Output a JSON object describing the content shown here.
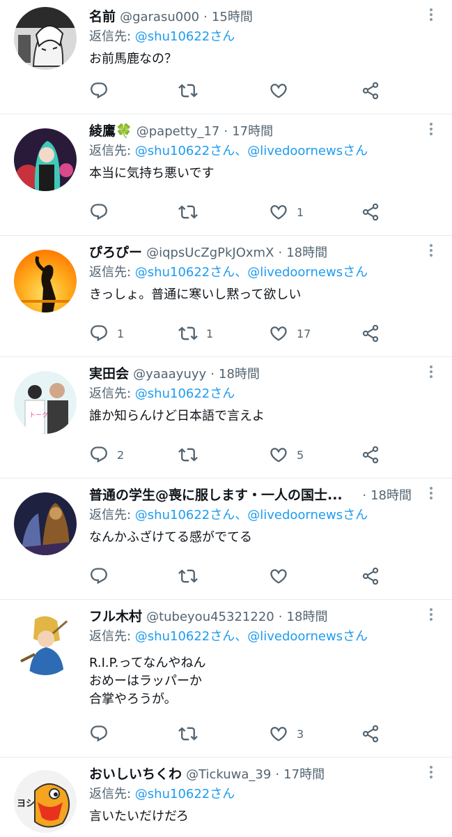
{
  "reply_prefix": "返信先: ",
  "tweets": [
    {
      "name": "名前",
      "name_suffix": "",
      "handle": "@garasu000",
      "time": "15時間",
      "reply_to": "@shu10622さん",
      "text": "お前馬鹿なの？",
      "counts": {
        "reply": "",
        "retweet": "",
        "like": ""
      }
    },
    {
      "name": "綾鷹",
      "name_suffix": "🍀",
      "handle": "@papetty_17",
      "time": "17時間",
      "reply_to": "@shu10622さん、@livedoornewsさん",
      "text": "本当に気持ち悪いです",
      "counts": {
        "reply": "",
        "retweet": "",
        "like": "1"
      }
    },
    {
      "name": "ぴろぴー",
      "name_suffix": "",
      "handle": "@iqpsUcZgPkJOxmX",
      "time": "18時間",
      "reply_to": "@shu10622さん、@livedoornewsさん",
      "text": "きっしょ。普通に寒いし黙って欲しい",
      "counts": {
        "reply": "1",
        "retweet": "1",
        "like": "17"
      }
    },
    {
      "name": "実田会",
      "name_suffix": "",
      "handle": "@yaaayuyy",
      "time": "18時間",
      "reply_to": "@shu10622さん",
      "text": "誰か知らんけど日本語で言えよ",
      "counts": {
        "reply": "2",
        "retweet": "",
        "like": "5"
      }
    },
    {
      "name": "普通の学生@喪に服します・一人の国士...",
      "name_suffix": "",
      "handle": "",
      "time": "18時間",
      "reply_to": "@shu10622さん、@livedoornewsさん",
      "text": "なんかふざけてる感がでてる",
      "counts": {
        "reply": "",
        "retweet": "",
        "like": ""
      }
    },
    {
      "name": "フル木村",
      "name_suffix": "",
      "handle": "@tubeyou45321220",
      "time": "18時間",
      "reply_to": "@shu10622さん、@livedoornewsさん",
      "text": "R.I.P.ってなんやねん\nおめーはラッパーか\n合掌やろうが。",
      "counts": {
        "reply": "",
        "retweet": "",
        "like": "3"
      }
    },
    {
      "name": "おいしいちくわ",
      "name_suffix": "",
      "handle": "@Tickuwa_39",
      "time": "17時間",
      "reply_to": "@shu10622さん",
      "text": "言いたいだけだろ",
      "counts": {
        "reply": "",
        "retweet": "",
        "like": ""
      }
    }
  ],
  "avatar_logo_text": "ヨシ",
  "icons": {
    "reply": "reply-icon",
    "retweet": "retweet-icon",
    "like": "heart-icon",
    "share": "share-icon",
    "more": "more-options-icon"
  },
  "colors": {
    "link": "#1d9bf0",
    "meta": "#536471",
    "text": "#0f1419",
    "clover": "#2fa84f"
  }
}
